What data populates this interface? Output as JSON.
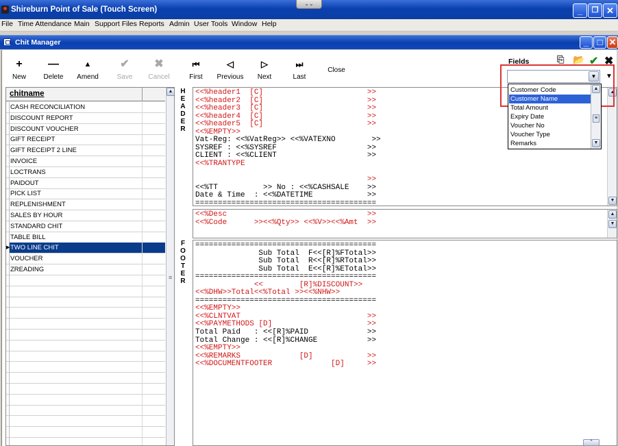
{
  "app": {
    "title": "Shireburn Point of Sale (Touch Screen)",
    "window_buttons": {
      "minimize": "_",
      "restore": "❐",
      "close": "✕"
    }
  },
  "menu": [
    "File",
    "Time Attendance",
    "Main",
    "Support Files",
    "Reports",
    "Admin",
    "User Tools",
    "Window",
    "Help"
  ],
  "child_window": {
    "title": "Chit Manager",
    "buttons": {
      "minimize": "_",
      "maximize": "□",
      "close": "✕"
    }
  },
  "toolbar": [
    {
      "label": "New",
      "glyph": "+",
      "enabled": true
    },
    {
      "label": "Delete",
      "glyph": "—",
      "enabled": true
    },
    {
      "label": "Amend",
      "glyph": "▲",
      "enabled": true
    },
    {
      "label": "Save",
      "glyph": "✔",
      "enabled": false
    },
    {
      "label": "Cancel",
      "glyph": "✖",
      "enabled": false
    },
    {
      "label": "First",
      "glyph": "⏮",
      "enabled": true
    },
    {
      "label": "Previous",
      "glyph": "◁",
      "enabled": true
    },
    {
      "label": "Next",
      "glyph": "▷",
      "enabled": true
    },
    {
      "label": "Last",
      "glyph": "⏭",
      "enabled": true
    },
    {
      "label": "Close",
      "glyph": "",
      "enabled": true
    }
  ],
  "chit_list": {
    "column_header": "chitname",
    "rows": [
      "CASH RECONCILIATION",
      "DISCOUNT REPORT",
      "DISCOUNT VOUCHER",
      "GIFT RECEIPT",
      "GIFT RECEIPT 2 LINE",
      "INVOICE",
      "LOCTRANS",
      "PAIDOUT",
      "PICK LIST",
      "REPLENISHMENT",
      "SALES BY HOUR",
      "STANDARD CHIT",
      "TABLE BILL",
      "TWO LINE CHIT",
      "VOUCHER",
      "ZREADING"
    ],
    "selected": "TWO LINE CHIT"
  },
  "side_labels": {
    "header": "HEADER",
    "footer": "FOOTER"
  },
  "header_lines": [
    [
      "<<%header1  [C]                       >>",
      true
    ],
    [
      "<<%header2  [C]                       >>",
      true
    ],
    [
      "<<%header3  [C]                       >>",
      true
    ],
    [
      "<<%header4  [C]                       >>",
      true
    ],
    [
      "<<%header5  [C]                       >>",
      true
    ],
    [
      "<<%EMPTY>>",
      true
    ],
    [
      "Vat-Reg: <<%VatReg>> <<%VATEXNO        >>",
      false
    ],
    [
      "SYSREF : <<%SYSREF                    >>",
      false
    ],
    [
      "CLIENT : <<%CLIENT                    >>",
      false
    ],
    [
      "<<%TRANTYPE",
      true
    ],
    [
      "",
      false
    ],
    [
      "                                      >>",
      true
    ],
    [
      "<<%TT          >> No : <<%CASHSALE    >>",
      false
    ],
    [
      "Date & Time  : <<%DATETIME            >>",
      false
    ],
    [
      "========================================",
      false
    ]
  ],
  "detail_lines": [
    [
      "<<%Desc                               >>",
      true
    ],
    [
      "<<%Code      >><<%Qty>> <<%V>><<%Amt  >>",
      true
    ]
  ],
  "footer_lines": [
    [
      "========================================",
      false
    ],
    [
      "              Sub Total  F<<[R]%FTotal>>",
      false
    ],
    [
      "              Sub Total  R<<[R]%RTotal>>",
      false
    ],
    [
      "              Sub Total  E<<[R]%ETotal>>",
      false
    ],
    [
      "========================================",
      false
    ],
    [
      "             <<        [R]%DISCOUNT>>",
      true
    ],
    [
      "<<%DHW>>Total<<%Total >><<%NHW>>",
      true
    ],
    [
      "========================================",
      false
    ],
    [
      "<<%EMPTY>>",
      true
    ],
    [
      "<<%CLNTVAT                            >>",
      true
    ],
    [
      "<<%PAYMETHODS [D]                     >>",
      true
    ],
    [
      "Total Paid   : <<[R]%PAID             >>",
      false
    ],
    [
      "Total Change : <<[R]%CHANGE           >>",
      false
    ],
    [
      "<<%EMPTY>>",
      true
    ],
    [
      "<<%REMARKS             [D]            >>",
      true
    ],
    [
      "<<%DOCUMENTFOOTER             [D]     >>",
      true
    ]
  ],
  "fields_panel": {
    "label": "Fields",
    "combo_value": "",
    "options": [
      "Customer Code",
      "Customer Name",
      "Total Amount",
      "Expiry Date",
      "Voucher No",
      "Voucher Type",
      "Remarks"
    ],
    "highlighted": "Customer Name",
    "action_icons": [
      "insert-field-icon",
      "open-folder-icon",
      "ok-check-icon",
      "cancel-x-icon"
    ]
  }
}
